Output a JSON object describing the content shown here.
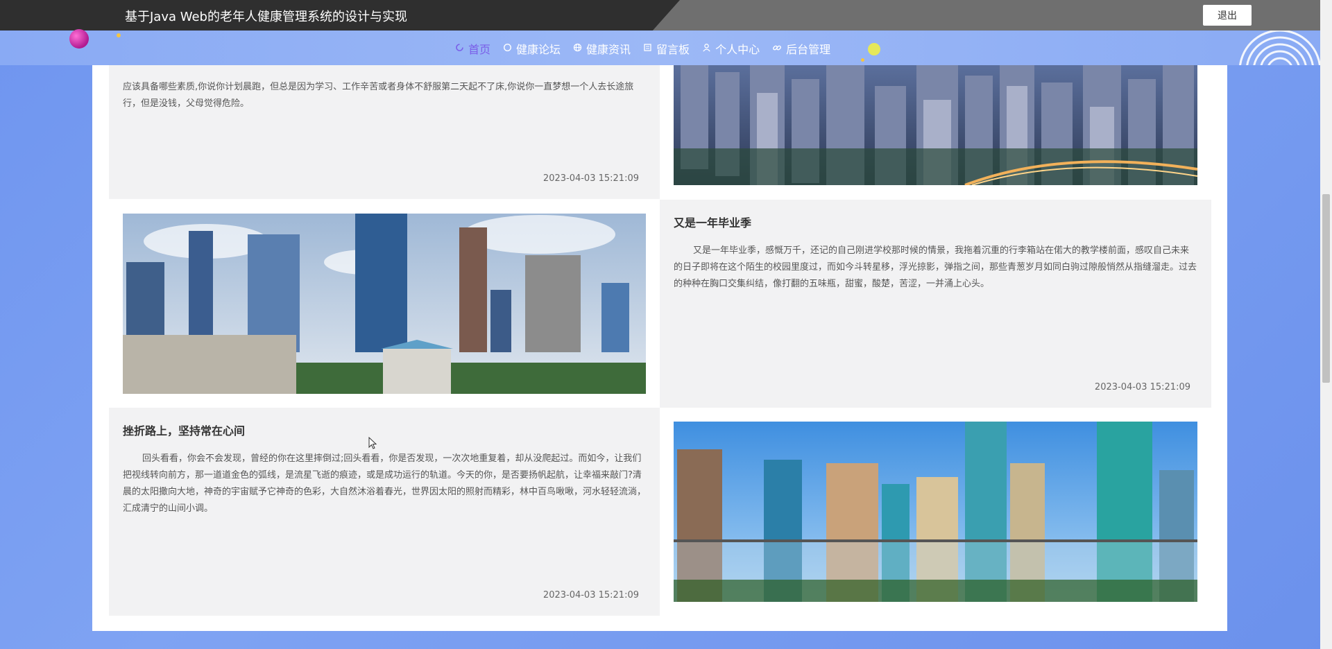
{
  "header": {
    "title": "基于Java Web的老年人健康管理系统的设计与实现",
    "logout_label": "退出"
  },
  "nav": {
    "items": [
      {
        "label": "首页",
        "icon": "home-icon",
        "active": true
      },
      {
        "label": "健康论坛",
        "icon": "chat-icon",
        "active": false
      },
      {
        "label": "健康资讯",
        "icon": "globe-icon",
        "active": false
      },
      {
        "label": "留言板",
        "icon": "message-icon",
        "active": false
      },
      {
        "label": "个人中心",
        "icon": "user-icon",
        "active": false
      },
      {
        "label": "后台管理",
        "icon": "link-icon",
        "active": false
      }
    ]
  },
  "articles": [
    {
      "title": "",
      "body": "应该具备哪些素质,你说你计划晨跑，但总是因为学习、工作辛苦或者身体不舒服第二天起不了床,你说你一直梦想一个人去长途旅行，但是没钱，父母觉得危险。",
      "date": "2023-04-03 15:21:09",
      "image": "city-night-skyline-image"
    },
    {
      "title": "又是一年毕业季",
      "body": "又是一年毕业季，感慨万千，还记的自己刚进学校那时候的情景，我拖着沉重的行李箱站在偌大的教学楼前面，感叹自己未来的日子即将在这个陌生的校园里度过，而如今斗转星移，浮光掠影，弹指之间，那些青葱岁月如同白驹过隙般悄然从指缝溜走。过去的种种在胸口交集纠结，像打翻的五味瓶，甜蜜，酸楚，苦涩，一并涌上心头。",
      "date": "2023-04-03 15:21:09",
      "image": "city-day-skyline-image"
    },
    {
      "title": "挫折路上，坚持常在心间",
      "body": "回头看看，你会不会发现，曾经的你在这里摔倒过;回头看看，你是否发现，一次次地重复着，却从没爬起过。而如今，让我们把视线转向前方，那一道道金色的弧线，是流星飞逝的痕迹，或是成功运行的轨道。今天的你，是否要扬帆起航，让幸福来敲门?清晨的太阳撒向大地，神奇的宇宙赋予它神奇的色彩，大自然沐浴着春光，世界因太阳的照射而精彩，林中百鸟啾啾，河水轻轻流淌，汇成清宁的山间小调。",
      "date": "2023-04-03 15:21:09",
      "image": "glass-towers-image"
    }
  ],
  "colors": {
    "background": "#7fa3f3",
    "active_nav": "#7a5ee8",
    "card": "#f2f2f3"
  }
}
